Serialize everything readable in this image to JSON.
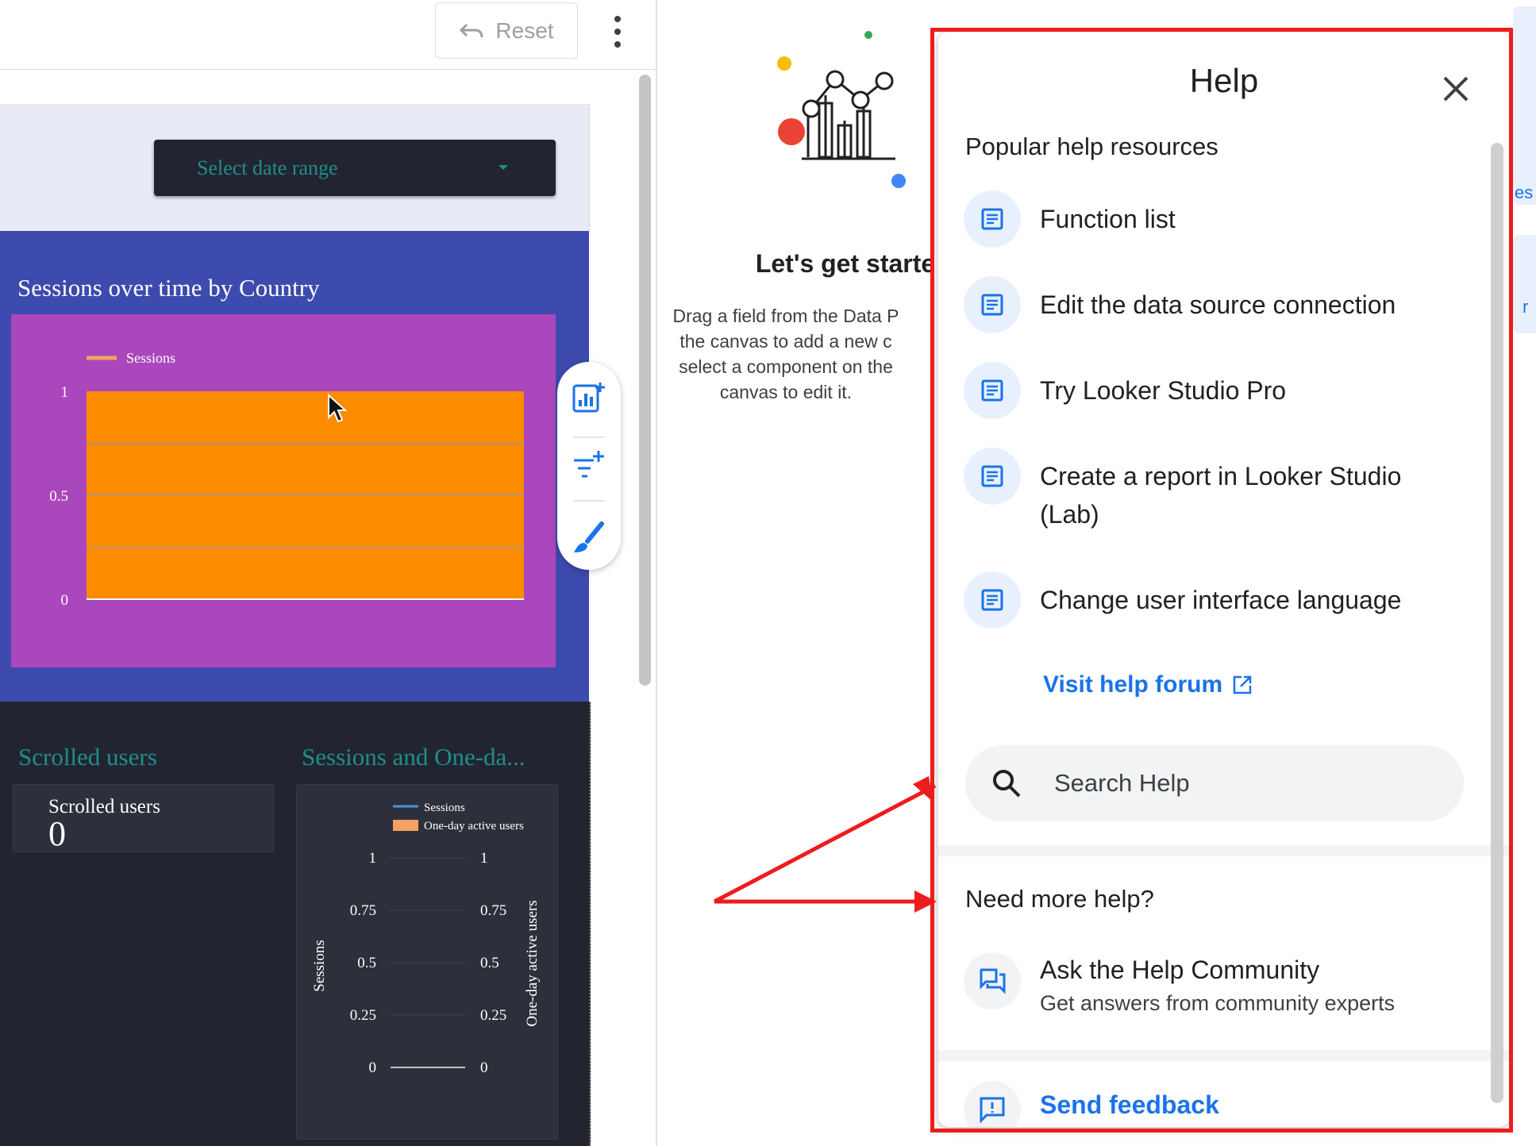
{
  "toolbar": {
    "reset_label": "Reset"
  },
  "date_selector": {
    "label": "Select date range"
  },
  "sessions_chart": {
    "title": "Sessions over time by Country",
    "legend": "Sessions",
    "y_ticks": [
      "1",
      "0.5",
      "0"
    ]
  },
  "scorecard": {
    "section_title": "Scrolled users",
    "label": "Scrolled users",
    "value": "0"
  },
  "combo_chart": {
    "section_title": "Sessions and One-da...",
    "legend": [
      "Sessions",
      "One-day active users"
    ],
    "left_axis_label": "Sessions",
    "right_axis_label": "One-day active users",
    "left_ticks": [
      "1",
      "0.75",
      "0.5",
      "0.25",
      "0"
    ],
    "right_ticks": [
      "1",
      "0.75",
      "0.5",
      "0.25",
      "0"
    ]
  },
  "get_started": {
    "heading": "Let's get starte",
    "lines": [
      "Drag a field from the Data P",
      "the canvas to add a new c",
      "select a component on the",
      "canvas to edit it."
    ]
  },
  "help": {
    "title": "Help",
    "popular_heading": "Popular help resources",
    "resources": [
      "Function list",
      "Edit the data source connection",
      "Try Looker Studio Pro",
      "Create a report in Looker Studio (Lab)",
      "Change user interface language"
    ],
    "forum_link": "Visit help forum",
    "search_placeholder": "Search Help",
    "more_help_heading": "Need more help?",
    "community_title": "Ask the Help Community",
    "community_subtitle": "Get answers from community experts",
    "feedback_label": "Send feedback"
  },
  "right_edge_fragments": [
    "es",
    "r"
  ],
  "chart_data": [
    {
      "type": "bar",
      "title": "Sessions over time by Country",
      "series": [
        {
          "name": "Sessions",
          "values": [
            1
          ]
        }
      ],
      "ylim": [
        0,
        1
      ]
    },
    {
      "type": "line",
      "title": "Sessions and One-da...",
      "ylabel": "Sessions",
      "y2label": "One-day active users",
      "series": [
        {
          "name": "Sessions",
          "values": [
            0
          ]
        },
        {
          "name": "One-day active users",
          "values": [
            0
          ]
        }
      ],
      "ylim": [
        0,
        1
      ]
    }
  ],
  "colors": {
    "canvas_blue": "#3d4aae",
    "chart_purple": "#ab47bc",
    "bar_orange": "#fb8c00",
    "teal_text": "#1f8e8e",
    "help_blue": "#1a73e8",
    "highlight_red": "#ee1c1c"
  }
}
